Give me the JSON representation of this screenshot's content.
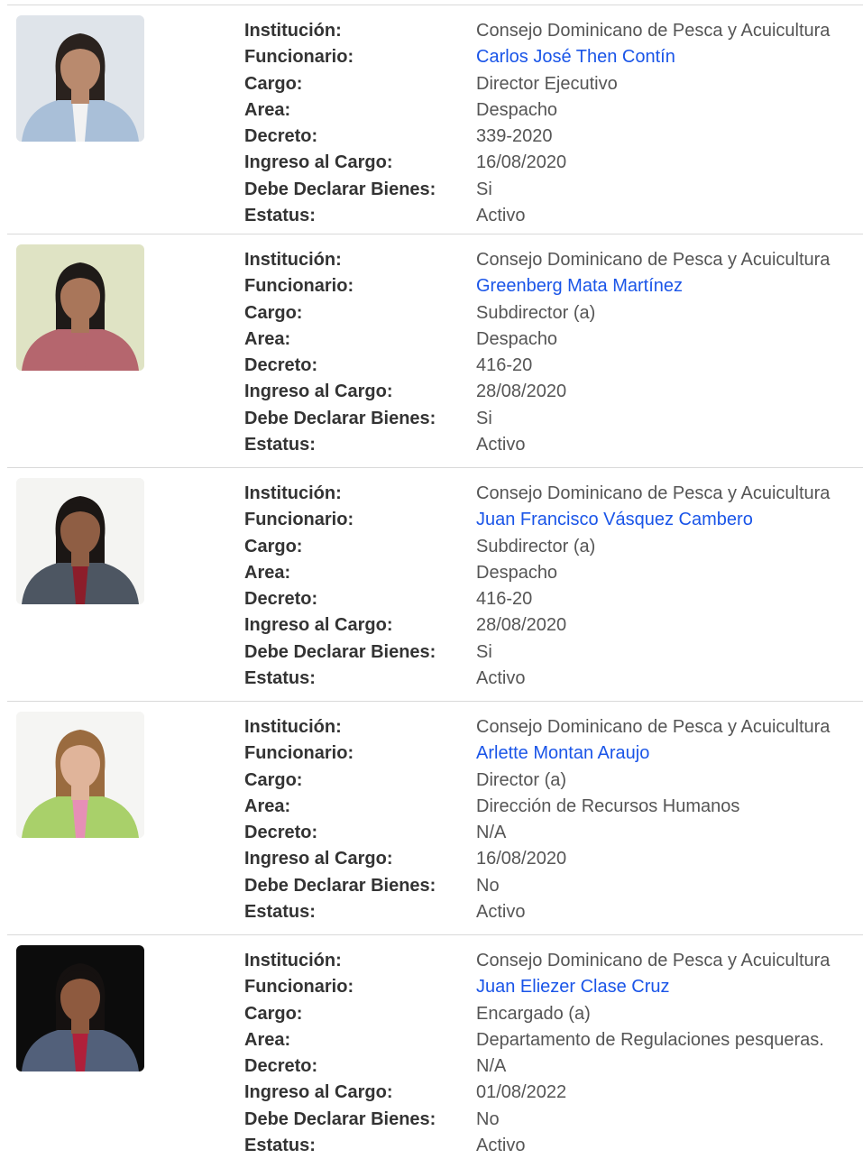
{
  "labels": {
    "institucion": "Institución:",
    "funcionario": "Funcionario:",
    "cargo": "Cargo:",
    "area": "Area:",
    "decreto": "Decreto:",
    "ingreso": "Ingreso al Cargo:",
    "declarar": "Debe Declarar Bienes:",
    "estatus": "Estatus:"
  },
  "officials": [
    {
      "institucion": "Consejo Dominicano de Pesca y Acuicultura",
      "funcionario": "Carlos José Then Contín",
      "cargo": "Director Ejecutivo",
      "area": "Despacho",
      "decreto": "339-2020",
      "ingreso": "16/08/2020",
      "declarar": "Si",
      "estatus": "Activo",
      "photo": {
        "bg": "#dfe4ea",
        "skin": "#b98a6e",
        "hair": "#2a221e",
        "clothing": "#a9bfd8",
        "accent": "#f2f2f2"
      }
    },
    {
      "institucion": "Consejo Dominicano de Pesca y Acuicultura",
      "funcionario": "Greenberg Mata Martínez",
      "cargo": "Subdirector (a)",
      "area": "Despacho",
      "decreto": "416-20",
      "ingreso": "28/08/2020",
      "declarar": "Si",
      "estatus": "Activo",
      "photo": {
        "bg": "#dfe3c4",
        "skin": "#a9765a",
        "hair": "#1e1a18",
        "clothing": "#b5666e",
        "accent": "#b5666e"
      }
    },
    {
      "institucion": "Consejo Dominicano de Pesca y Acuicultura",
      "funcionario": "Juan Francisco Vásquez Cambero",
      "cargo": "Subdirector (a)",
      "area": "Despacho",
      "decreto": "416-20",
      "ingreso": "28/08/2020",
      "declarar": "Si",
      "estatus": "Activo",
      "photo": {
        "bg": "#f4f4f2",
        "skin": "#8f5e44",
        "hair": "#1b1614",
        "clothing": "#4d5662",
        "accent": "#8c1d2a"
      }
    },
    {
      "institucion": "Consejo Dominicano de Pesca y Acuicultura",
      "funcionario": "Arlette Montan Araujo",
      "cargo": "Director (a)",
      "area": "Dirección de Recursos Humanos",
      "decreto": "N/A",
      "ingreso": "16/08/2020",
      "declarar": "No",
      "estatus": "Activo",
      "photo": {
        "bg": "#f5f5f3",
        "skin": "#e0b49a",
        "hair": "#9a6b3f",
        "clothing": "#a9d06a",
        "accent": "#e68fb6"
      }
    },
    {
      "institucion": "Consejo Dominicano de Pesca y Acuicultura",
      "funcionario": "Juan Eliezer Clase Cruz",
      "cargo": "Encargado (a)",
      "area": "Departamento de Regulaciones pesqueras.",
      "decreto": "N/A",
      "ingreso": "01/08/2022",
      "declarar": "No",
      "estatus": "Activo",
      "photo": {
        "bg": "#0c0c0c",
        "skin": "#8e5a3f",
        "hair": "#151110",
        "clothing": "#52607a",
        "accent": "#b0203a"
      }
    }
  ]
}
